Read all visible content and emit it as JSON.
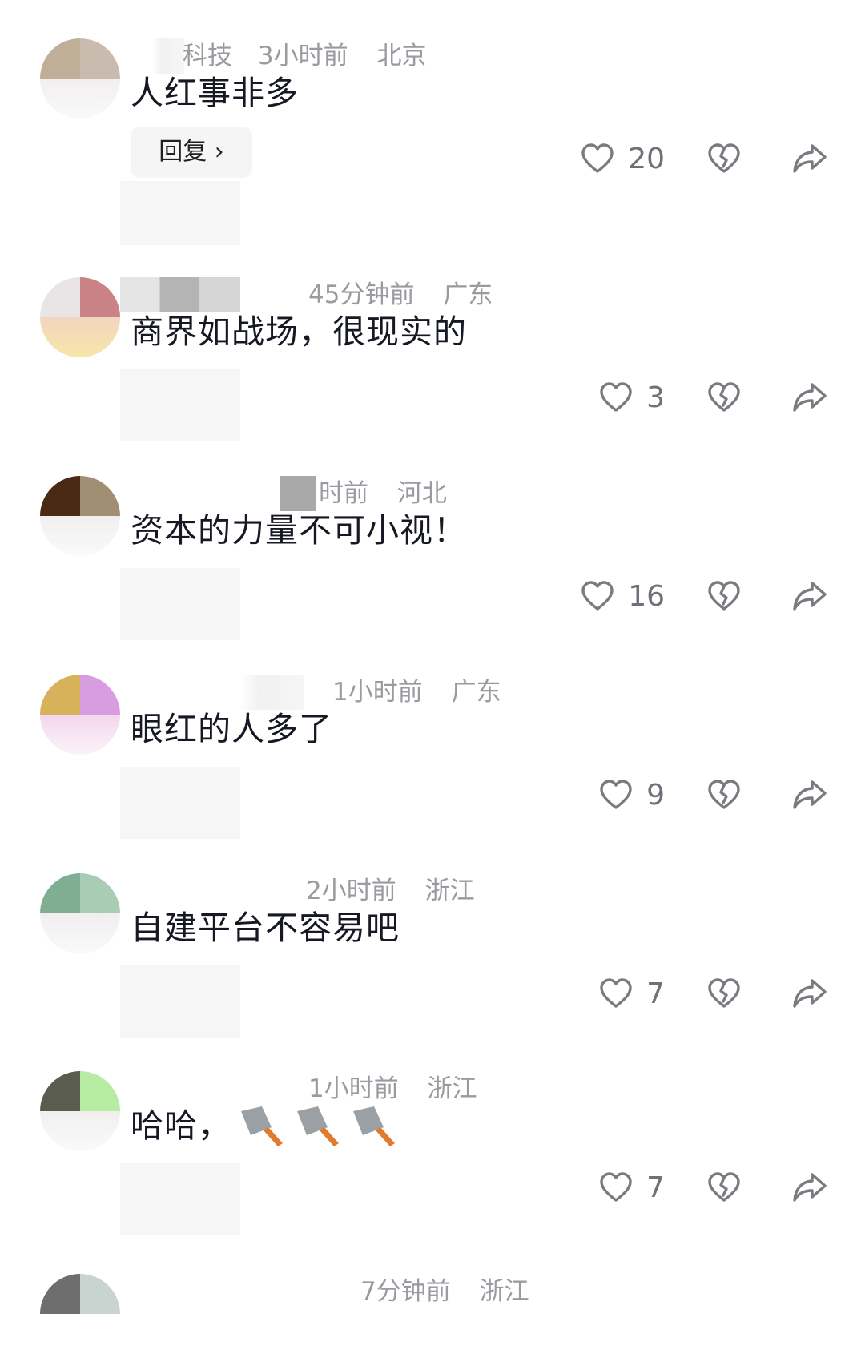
{
  "comments": [
    {
      "name_visible": "科技",
      "time": "3小时前",
      "location": "北京",
      "text": "人红事非多",
      "likes": "20",
      "reply_label": "回复 ›",
      "avatar_colors": [
        "#bfae98",
        "#c9bcae"
      ]
    },
    {
      "name_visible": "",
      "time": "45分钟前",
      "location": "广东",
      "text": "商界如战场，很现实的",
      "likes": "3",
      "avatar_colors": [
        "#e9e4e6",
        "#c98286"
      ]
    },
    {
      "name_visible": "",
      "time": "时前",
      "location": "河北",
      "text": "资本的力量不可小视！",
      "likes": "16",
      "avatar_colors": [
        "#4a2a12",
        "#a08f73"
      ]
    },
    {
      "name_visible": "",
      "time": "1小时前",
      "location": "广东",
      "text": "眼红的人多了",
      "likes": "9",
      "avatar_colors": [
        "#d7b25a",
        "#d89ce0"
      ]
    },
    {
      "name_visible": "",
      "time": "2小时前",
      "location": "浙江",
      "text": "自建平台不容易吧",
      "likes": "7",
      "avatar_colors": [
        "#7fae93",
        "#a8ccb4"
      ]
    },
    {
      "name_visible": "",
      "time": "1小时前",
      "location": "浙江",
      "text": "哈哈，",
      "emoji_count": 3,
      "emoji_name": "kitchen-knife-emoji",
      "likes": "7",
      "avatar_colors": [
        "#5a5c4d",
        "#b6eca4"
      ]
    },
    {
      "name_visible": "",
      "time": "7分钟前",
      "location": "浙江",
      "text": "",
      "likes": "",
      "avatar_colors": [
        "#6e6e6e",
        "#c9d3cf"
      ]
    }
  ],
  "icons": {
    "like": "heart-outline-icon",
    "dislike": "broken-heart-icon",
    "share": "share-arrow-icon"
  }
}
